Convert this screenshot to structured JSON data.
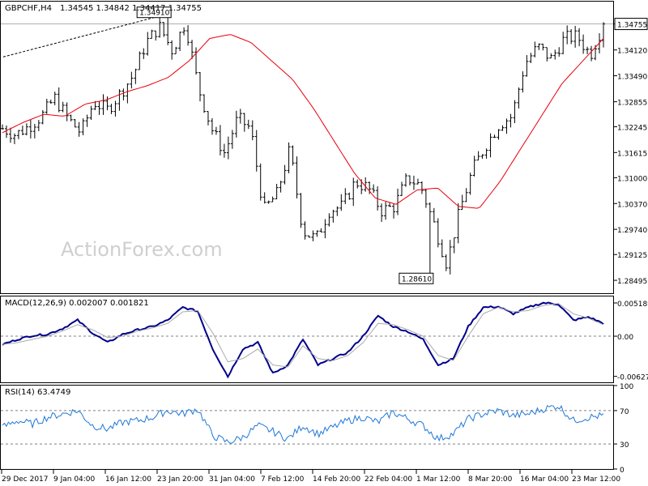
{
  "header": {
    "symbol": "GBPCHF,H4",
    "ohlc": "1.34545 1.34842 1.34417 1.34755"
  },
  "watermark": "ActionForex.com",
  "colors": {
    "candle": "#000000",
    "ma": "#e8000b",
    "macd": "#00008b",
    "signal": "#a9a9a9",
    "rsi": "#1e78d7",
    "grid_dashed": "#808080",
    "price_line": "#b0b0b0"
  },
  "chart_data": [
    {
      "type": "candlestick",
      "title": "GBPCHF,H4",
      "current_price_label": "1.34755",
      "y_ticks": [
        "1.34755",
        "1.34120",
        "1.33490",
        "1.32855",
        "1.32245",
        "1.31615",
        "1.31000",
        "1.30370",
        "1.29740",
        "1.29125",
        "1.28495"
      ],
      "ylim": [
        1.2818,
        1.353
      ],
      "x_ticks": [
        "29 Dec 2017",
        "9 Jan 04:00",
        "16 Jan 12:00",
        "23 Jan 20:00",
        "31 Jan 04:00",
        "7 Feb 12:00",
        "14 Feb 20:00",
        "22 Feb 04:00",
        "1 Mar 12:00",
        "8 Mar 20:00",
        "16 Mar 04:00",
        "23 Mar 12:00"
      ],
      "annotations": [
        {
          "label": "1.34910",
          "value": 1.3491,
          "kind": "high"
        },
        {
          "label": "1.28610",
          "value": 1.2861,
          "kind": "low"
        }
      ],
      "trendline": {
        "style": "dashed",
        "from_value": 1.3395,
        "to_value": 1.3491
      },
      "moving_average_anchors": [
        1.321,
        1.3235,
        1.3255,
        1.325,
        1.328,
        1.329,
        1.331,
        1.3325,
        1.3345,
        1.3385,
        1.344,
        1.345,
        1.343,
        1.3385,
        1.334,
        1.327,
        1.319,
        1.311,
        1.305,
        1.3035,
        1.307,
        1.3075,
        1.303,
        1.3025,
        1.309,
        1.317,
        1.325,
        1.333,
        1.3385,
        1.344
      ],
      "close_anchors": [
        1.322,
        1.3205,
        1.3225,
        1.325,
        1.3295,
        1.3245,
        1.321,
        1.3285,
        1.3265,
        1.3305,
        1.335,
        1.343,
        1.347,
        1.341,
        1.348,
        1.332,
        1.322,
        1.316,
        1.3245,
        1.322,
        1.302,
        1.306,
        1.317,
        1.297,
        1.295,
        1.302,
        1.303,
        1.309,
        1.3075,
        1.302,
        1.303,
        1.31,
        1.308,
        1.299,
        1.289,
        1.302,
        1.312,
        1.318,
        1.323,
        1.325,
        1.338,
        1.342,
        1.339,
        1.344,
        1.3445,
        1.34,
        1.3476
      ]
    },
    {
      "type": "line",
      "title": "MACD(12,26,9) 0.002007 0.001821",
      "y_ticks": [
        "0.005189",
        "0.00",
        "-0.006272"
      ],
      "ylim": [
        -0.0072,
        0.0062
      ],
      "series": [
        {
          "name": "MACD",
          "values": [
            -0.0013,
            -0.0005,
            0.0001,
            0.0003,
            0.0012,
            0.0025,
            0.0005,
            -0.001,
            0.0003,
            0.001,
            0.0015,
            0.0025,
            0.0045,
            0.0039,
            -0.002,
            -0.0063,
            -0.002,
            -0.001,
            -0.0058,
            -0.0045,
            -0.0005,
            -0.0045,
            -0.0035,
            -0.0025,
            0.0,
            0.0032,
            0.0015,
            0.0007,
            -0.0005,
            -0.0045,
            -0.0035,
            0.0015,
            0.0045,
            0.0046,
            0.0035,
            0.0045,
            0.0052,
            0.005,
            0.0025,
            0.003,
            0.002
          ]
        },
        {
          "name": "Signal",
          "values": [
            -0.0013,
            -0.001,
            -0.0005,
            0.0,
            0.0008,
            0.0018,
            0.001,
            -0.0002,
            0.0,
            0.0008,
            0.0013,
            0.002,
            0.0038,
            0.004,
            0.0005,
            -0.004,
            -0.0035,
            -0.002,
            -0.0045,
            -0.0048,
            -0.0015,
            -0.0035,
            -0.0038,
            -0.003,
            -0.001,
            0.002,
            0.0018,
            0.001,
            0.0,
            -0.003,
            -0.0038,
            0.0,
            0.0035,
            0.0045,
            0.0038,
            0.004,
            0.0048,
            0.0051,
            0.0035,
            0.0028,
            0.0018
          ]
        }
      ]
    },
    {
      "type": "line",
      "title": "RSI(14) 63.4749",
      "y_ticks": [
        "100",
        "70",
        "30",
        "0"
      ],
      "ylim": [
        0,
        100
      ],
      "series": [
        {
          "name": "RSI",
          "values": [
            50,
            58,
            54,
            62,
            66,
            70,
            52,
            48,
            56,
            58,
            62,
            70,
            66,
            72,
            40,
            32,
            38,
            52,
            45,
            36,
            52,
            42,
            50,
            58,
            62,
            56,
            68,
            60,
            52,
            36,
            42,
            60,
            66,
            70,
            64,
            66,
            72,
            76,
            58,
            62,
            64
          ]
        }
      ]
    }
  ]
}
